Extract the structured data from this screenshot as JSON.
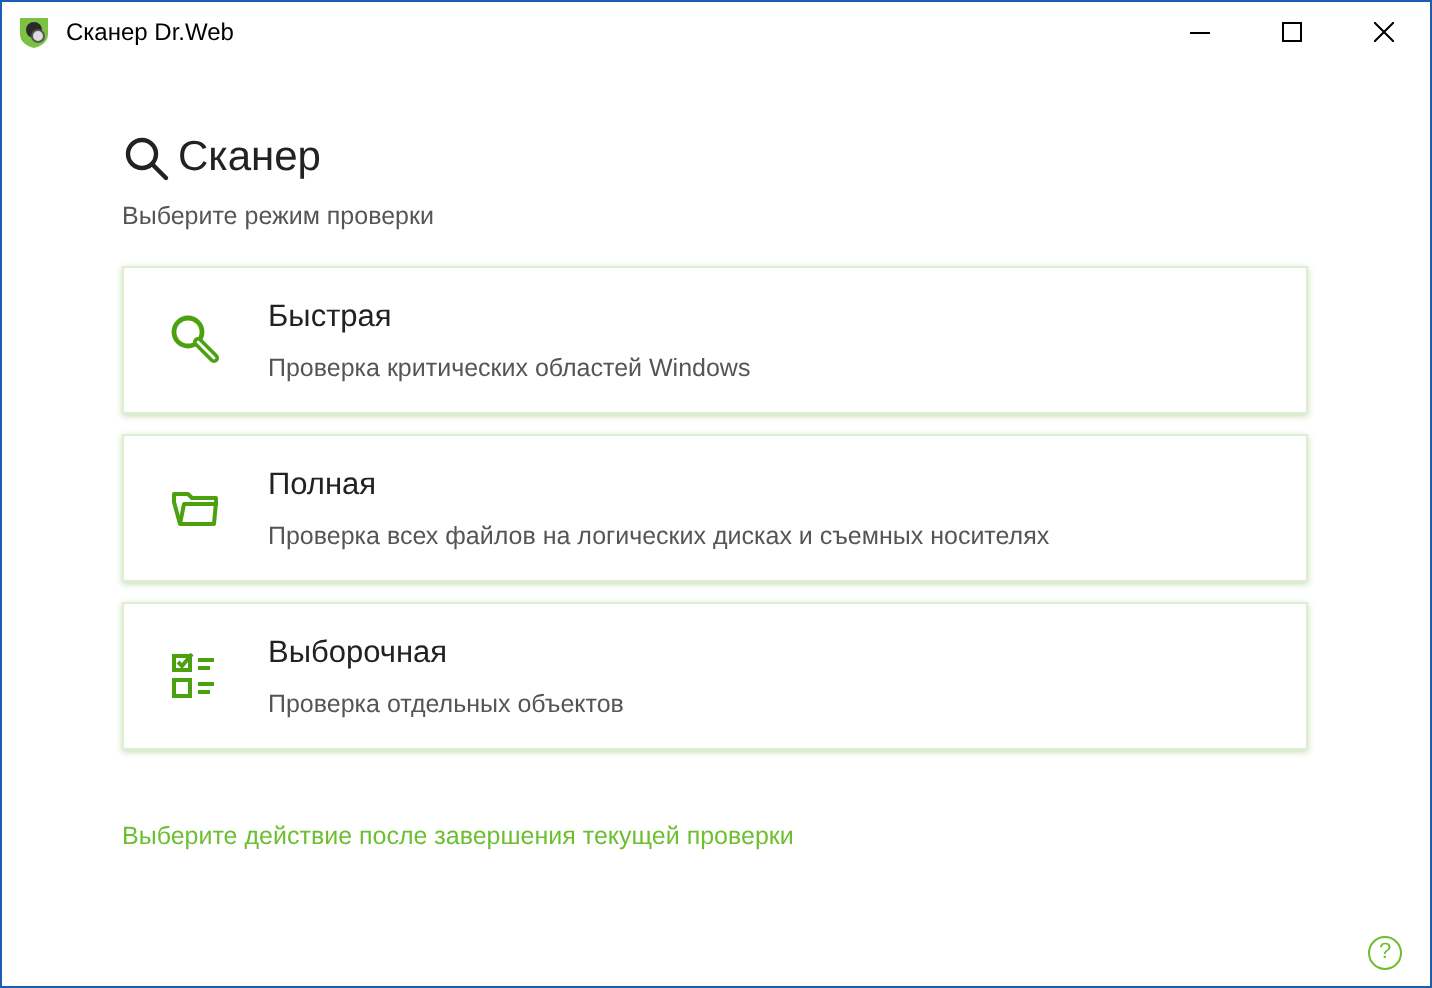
{
  "window": {
    "title": "Сканер Dr.Web"
  },
  "header": {
    "title": "Сканер",
    "subtitle": "Выберите режим проверки"
  },
  "modes": [
    {
      "kind": "quick",
      "title": "Быстрая",
      "description": "Проверка критических областей Windows"
    },
    {
      "kind": "full",
      "title": "Полная",
      "description": "Проверка всех файлов на логических дисках и съемных носителях"
    },
    {
      "kind": "custom",
      "title": "Выборочная",
      "description": "Проверка отдельных объектов"
    }
  ],
  "action_link": "Выберите действие после завершения текущей проверки",
  "help": "?"
}
